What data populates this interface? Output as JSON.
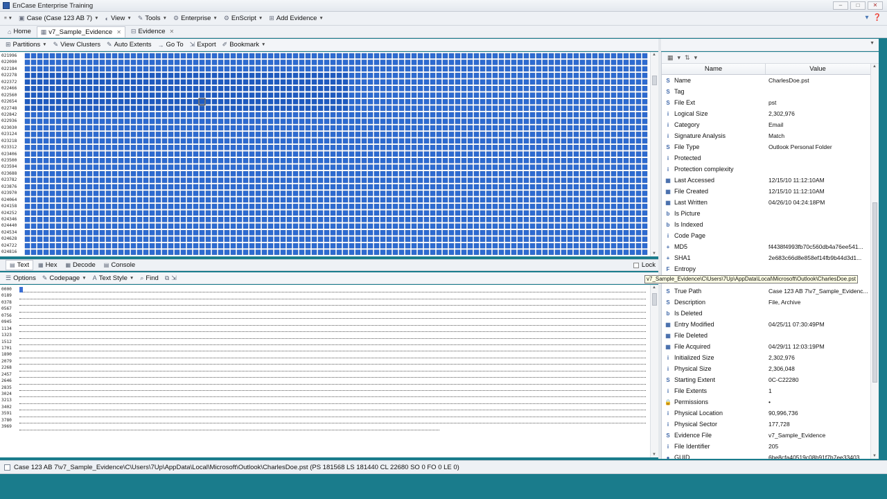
{
  "app": {
    "title": "EnCase Enterprise Training"
  },
  "menu": [
    {
      "label": "Case (Case 123 AB 7)",
      "icon": "case-icon"
    },
    {
      "label": "View",
      "icon": "view-icon"
    },
    {
      "label": "Tools",
      "icon": "tools-icon"
    },
    {
      "label": "Enterprise",
      "icon": "enterprise-icon"
    },
    {
      "label": "EnScript",
      "icon": "enscript-icon"
    },
    {
      "label": "Add Evidence",
      "icon": "add-evidence-icon"
    }
  ],
  "tabs": [
    {
      "label": "Home",
      "icon": "home-icon"
    },
    {
      "label": "v7_Sample_Evidence",
      "icon": "evidence-grid-icon"
    },
    {
      "label": "Evidence",
      "icon": "evidence-icon"
    }
  ],
  "disk_toolbar": [
    {
      "label": "Partitions",
      "dropdown": true
    },
    {
      "label": "View Clusters",
      "dropdown": false
    },
    {
      "label": "Auto Extents",
      "dropdown": false
    },
    {
      "label": "Go To",
      "dropdown": false
    },
    {
      "label": "Export",
      "dropdown": false
    },
    {
      "label": "Bookmark",
      "dropdown": true
    }
  ],
  "disk_offsets": [
    "021996",
    "022090",
    "022184",
    "022278",
    "022372",
    "022466",
    "022560",
    "022654",
    "022748",
    "022842",
    "022936",
    "023030",
    "023124",
    "023218",
    "023312",
    "023406",
    "023500",
    "023594",
    "023688",
    "023782",
    "023876",
    "023970",
    "024064",
    "024158",
    "024252",
    "024346",
    "024440",
    "024534",
    "024628",
    "024722",
    "024816"
  ],
  "view_tabs": [
    "Text",
    "Hex",
    "Decode",
    "Console"
  ],
  "lock_label": "Lock",
  "text_toolbar": [
    {
      "label": "Options",
      "dropdown": false
    },
    {
      "label": "Codepage",
      "dropdown": true
    },
    {
      "label": "Text Style",
      "dropdown": true
    },
    {
      "label": "Find",
      "dropdown": false
    }
  ],
  "text_offsets": [
    "0000",
    "0189",
    "0378",
    "0567",
    "0756",
    "0945",
    "1134",
    "1323",
    "1512",
    "1701",
    "1890",
    "2079",
    "2268",
    "2457",
    "2646",
    "2835",
    "3024",
    "3213",
    "3402",
    "3591",
    "3780",
    "3969"
  ],
  "props_header": {
    "name": "Name",
    "value": "Value"
  },
  "properties": [
    {
      "icon": "S",
      "name": "Name",
      "value": "CharlesDoe.pst"
    },
    {
      "icon": "S",
      "name": "Tag",
      "value": ""
    },
    {
      "icon": "S",
      "name": "File Ext",
      "value": "pst"
    },
    {
      "icon": "i",
      "name": "Logical Size",
      "value": "2,302,976"
    },
    {
      "icon": "i",
      "name": "Category",
      "value": "Email"
    },
    {
      "icon": "i",
      "name": "Signature Analysis",
      "value": "Match"
    },
    {
      "icon": "S",
      "name": "File Type",
      "value": "Outlook Personal Folder"
    },
    {
      "icon": "i",
      "name": "Protected",
      "value": ""
    },
    {
      "icon": "i",
      "name": "Protection complexity",
      "value": ""
    },
    {
      "icon": "▦",
      "name": "Last Accessed",
      "value": "12/15/10 11:12:10AM"
    },
    {
      "icon": "▦",
      "name": "File Created",
      "value": "12/15/10 11:12:10AM"
    },
    {
      "icon": "▦",
      "name": "Last Written",
      "value": "04/26/10 04:24:18PM"
    },
    {
      "icon": "b",
      "name": "Is Picture",
      "value": ""
    },
    {
      "icon": "b",
      "name": "Is Indexed",
      "value": ""
    },
    {
      "icon": "i",
      "name": "Code Page",
      "value": ""
    },
    {
      "icon": "+",
      "name": "MD5",
      "value": "f4438f4993fb70c560db4a76ee541..."
    },
    {
      "icon": "+",
      "name": "SHA1",
      "value": "2e683c66d8e858ef14fb9b44d3d1..."
    },
    {
      "icon": "F",
      "name": "Entropy",
      "value": ""
    },
    {
      "icon": "S",
      "name": "Item Path",
      "value": ""
    },
    {
      "icon": "S",
      "name": "True Path",
      "value": "Case 123 AB 7\\v7_Sample_Evidenc..."
    },
    {
      "icon": "S",
      "name": "Description",
      "value": "File, Archive"
    },
    {
      "icon": "b",
      "name": "Is Deleted",
      "value": ""
    },
    {
      "icon": "▦",
      "name": "Entry Modified",
      "value": "04/25/11 07:30:49PM"
    },
    {
      "icon": "▦",
      "name": "File Deleted",
      "value": ""
    },
    {
      "icon": "▦",
      "name": "File Acquired",
      "value": "04/29/11 12:03:19PM"
    },
    {
      "icon": "i",
      "name": "Initialized Size",
      "value": "2,302,976"
    },
    {
      "icon": "i",
      "name": "Physical Size",
      "value": "2,306,048"
    },
    {
      "icon": "S",
      "name": "Starting Extent",
      "value": "0C-C22280"
    },
    {
      "icon": "i",
      "name": "File Extents",
      "value": "1"
    },
    {
      "icon": "🔒",
      "name": "Permissions",
      "value": "•"
    },
    {
      "icon": "i",
      "name": "Physical Location",
      "value": "90,996,736"
    },
    {
      "icon": "i",
      "name": "Physical Sector",
      "value": "177,728"
    },
    {
      "icon": "S",
      "name": "Evidence File",
      "value": "v7_Sample_Evidence"
    },
    {
      "icon": "i",
      "name": "File Identifier",
      "value": "205"
    },
    {
      "icon": "●",
      "name": "GUID",
      "value": "6be8cfa40519c08b91f7b7ee33403..."
    }
  ],
  "tooltip": "v7_Sample_Evidence\\C\\Users\\7Up\\AppData\\Local\\Microsoft\\Outlook\\CharlesDoe.pst",
  "status": "Case 123 AB 7\\v7_Sample_Evidence\\C\\Users\\7Up\\AppData\\Local\\Microsoft\\Outlook\\CharlesDoe.pst (PS 181568  LS 181440  CL 22680 SO 0 FO 0 LE 0)",
  "colors": {
    "cluster_fill": "#2d6bd1",
    "cluster_border": "#1d4fa8",
    "taskbar": "#1a7c8c"
  }
}
